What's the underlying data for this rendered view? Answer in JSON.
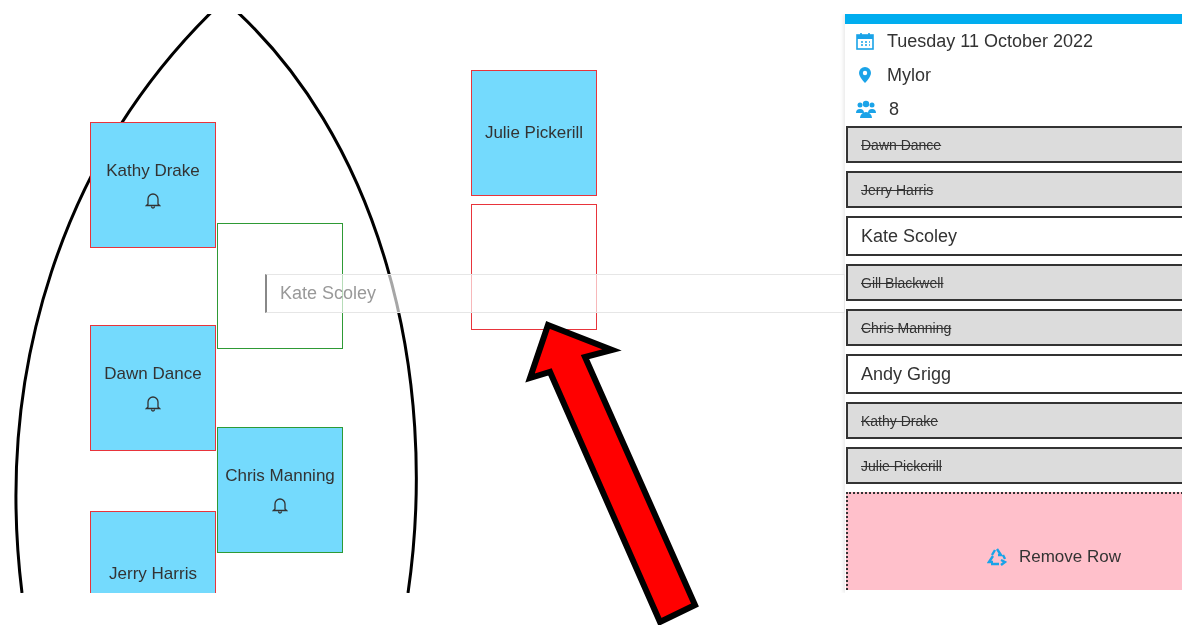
{
  "seats": [
    {
      "name": "Kathy Drake",
      "occupied": true,
      "alert": true,
      "color": "#e8343b"
    },
    {
      "occupied": false,
      "color": "#2e9a35"
    },
    {
      "name": "Dawn Dance",
      "occupied": true,
      "alert": true,
      "color": "#e8343b"
    },
    {
      "name": "Chris Manning",
      "occupied": true,
      "alert": true,
      "color": "#2e9a35"
    },
    {
      "name": "Jerry Harris",
      "occupied": true,
      "alert": false,
      "color": "#e8343b"
    },
    {
      "name": "Julie Pickerill",
      "occupied": true,
      "alert": false,
      "color": "#e8343b"
    },
    {
      "occupied": false,
      "color": "#e8343b"
    }
  ],
  "drag_ghost": {
    "label": "Kate Scoley"
  },
  "session": {
    "date": "Tuesday 11 October 2022",
    "location": "Mylor",
    "count": "8"
  },
  "crew": [
    {
      "name": "Dawn Dance",
      "assigned": true
    },
    {
      "name": "Jerry Harris",
      "assigned": true
    },
    {
      "name": "Kate Scoley",
      "assigned": false
    },
    {
      "name": "Gill Blackwell",
      "assigned": true
    },
    {
      "name": "Chris Manning",
      "assigned": true
    },
    {
      "name": "Andy Grigg",
      "assigned": false
    },
    {
      "name": "Kathy Drake",
      "assigned": true
    },
    {
      "name": "Julie Pickerill",
      "assigned": true
    }
  ],
  "remove_zone": {
    "label": "Remove Row"
  }
}
